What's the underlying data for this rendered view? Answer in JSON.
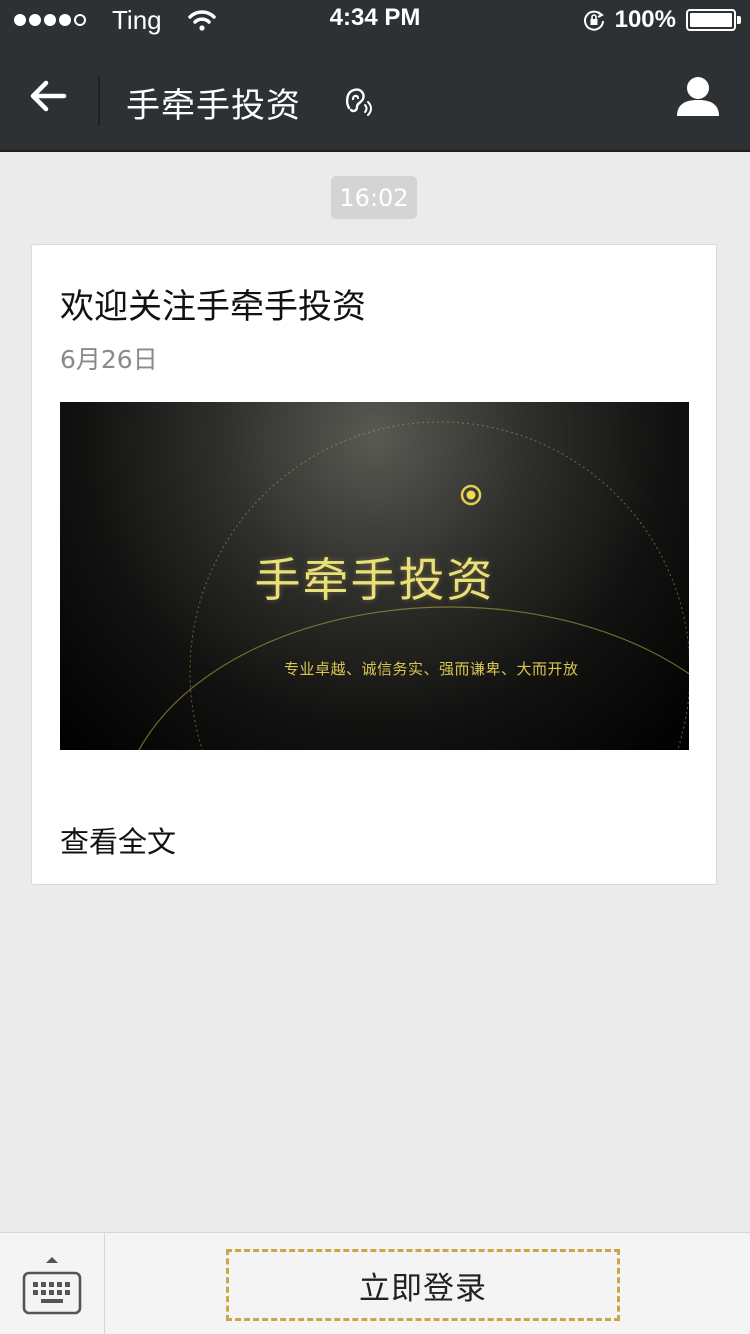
{
  "status_bar": {
    "carrier": "Ting",
    "time": "4:34 PM",
    "battery": "100%",
    "signal_strength": 4,
    "signal_max": 5,
    "battery_level": 1.0
  },
  "nav": {
    "title": "手牵手投资",
    "back_icon": "arrow-left-icon",
    "listen_icon": "ear-icon",
    "profile_icon": "person-icon"
  },
  "chat": {
    "timestamp": "16:02",
    "article": {
      "title": "欢迎关注手牵手投资",
      "date": "6月26日",
      "cover_title": "手牵手投资",
      "cover_slogan": "专业卓越、诚信务实、强而谦卑、大而开放",
      "read_more": "查看全文"
    }
  },
  "bottom": {
    "keyboard_icon": "keyboard-icon",
    "login_label": "立即登录"
  },
  "colors": {
    "bar_dark": "#2e3133",
    "background": "#ebebeb",
    "accent_gold": "#caa64a",
    "cover_text": "#e9e07a"
  }
}
